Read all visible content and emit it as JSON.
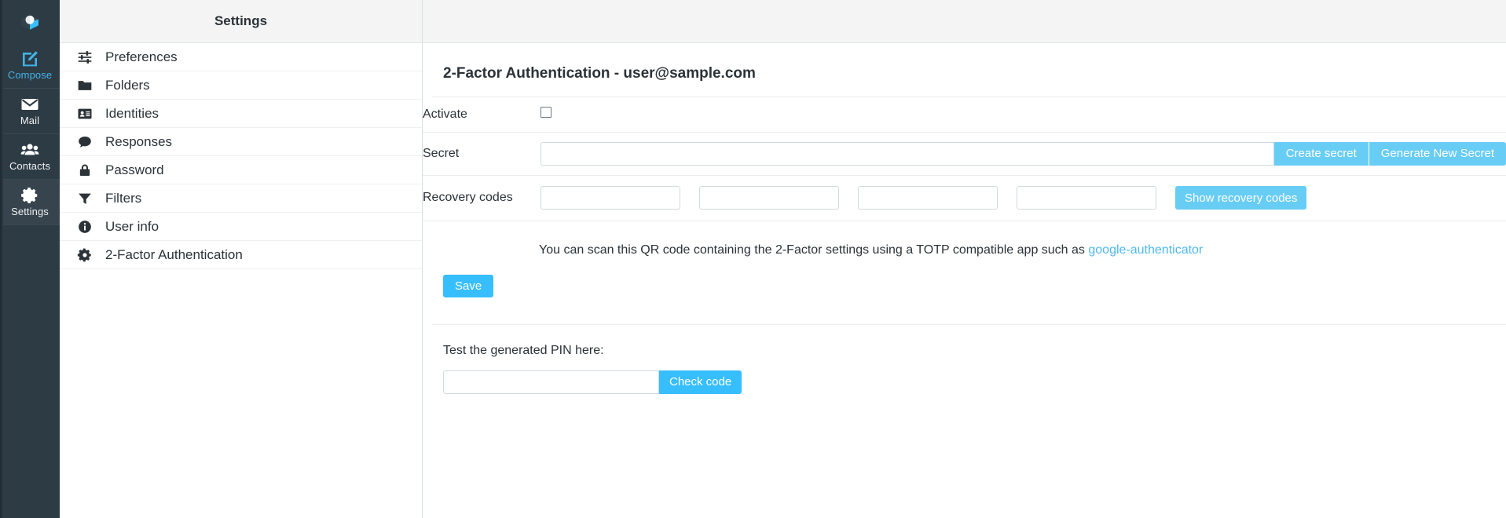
{
  "taskbar": {
    "logo_name": "roundcube-logo",
    "items": [
      {
        "label": "Compose",
        "icon": "compose-icon",
        "selected": false
      },
      {
        "label": "Mail",
        "icon": "mail-icon",
        "selected": false
      },
      {
        "label": "Contacts",
        "icon": "contacts-icon",
        "selected": false
      },
      {
        "label": "Settings",
        "icon": "gear-icon",
        "selected": true
      }
    ]
  },
  "settings_list": {
    "header": "Settings",
    "items": [
      {
        "label": "Preferences",
        "icon": "sliders-icon"
      },
      {
        "label": "Folders",
        "icon": "folder-icon"
      },
      {
        "label": "Identities",
        "icon": "id-card-icon"
      },
      {
        "label": "Responses",
        "icon": "speech-bubble-icon"
      },
      {
        "label": "Password",
        "icon": "lock-icon"
      },
      {
        "label": "Filters",
        "icon": "funnel-icon"
      },
      {
        "label": "User info",
        "icon": "info-icon"
      },
      {
        "label": "2-Factor Authentication",
        "icon": "gear-icon"
      }
    ]
  },
  "main": {
    "title": "2-Factor Authentication - user@sample.com",
    "activate": {
      "label": "Activate",
      "checked": false
    },
    "secret": {
      "label": "Secret",
      "value": "",
      "placeholder": "",
      "create_button": "Create secret",
      "generate_button": "Generate New Secret"
    },
    "recovery": {
      "label": "Recovery codes",
      "codes": [
        "",
        "",
        "",
        ""
      ],
      "show_button": "Show recovery codes"
    },
    "qr_note": {
      "text": "You can scan this QR code containing the 2-Factor settings using a TOTP compatible app such as ",
      "link_text": "google-authenticator"
    },
    "save_button": "Save",
    "test": {
      "label": "Test the generated PIN here:",
      "value": "",
      "placeholder": "",
      "check_button": "Check code"
    }
  },
  "colors": {
    "rail_bg": "#2d3b45",
    "accent": "#37beff",
    "accent_light": "#68cdf5",
    "link": "#4fb8ef",
    "header_bg": "#f4f4f4",
    "text": "#2b3238"
  }
}
